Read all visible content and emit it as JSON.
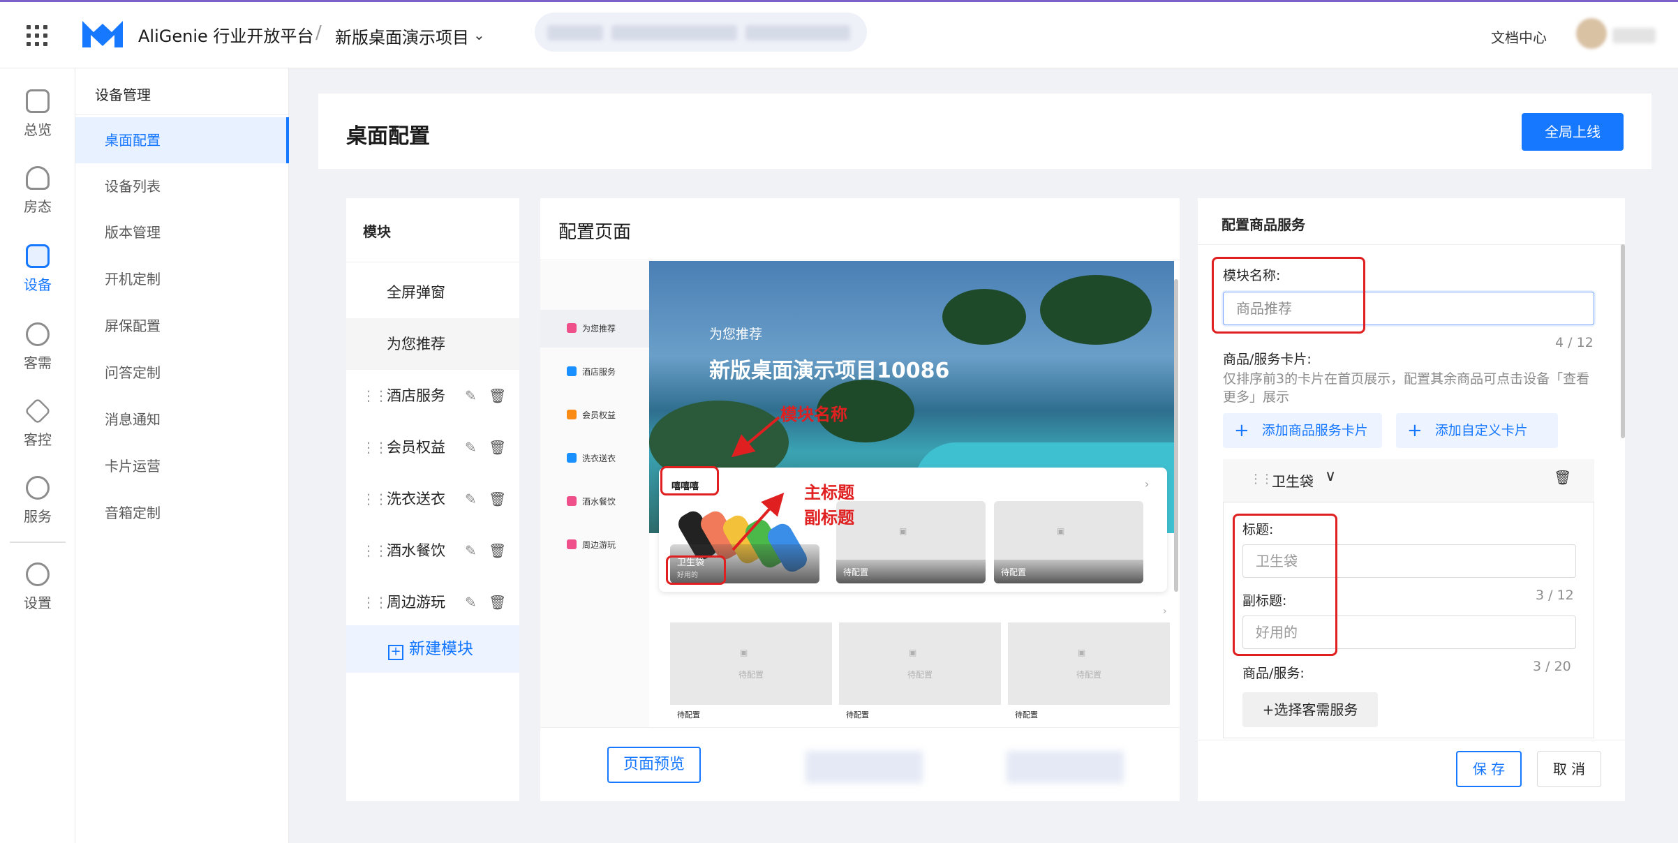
{
  "topbar": {
    "brand": "AliGenie 行业开放平台",
    "separator": "/",
    "project": "新版桌面演示项目",
    "doc_center": "文档中心",
    "icons": [
      "grid-icon",
      "logo-icon",
      "chevron-down-icon"
    ]
  },
  "leftnav": [
    {
      "label": "总览",
      "icon": "overview-icon"
    },
    {
      "label": "房态",
      "icon": "room-status-icon"
    },
    {
      "label": "设备",
      "icon": "device-icon",
      "active": true
    },
    {
      "label": "客需",
      "icon": "guest-needs-icon"
    },
    {
      "label": "客控",
      "icon": "guest-control-icon"
    },
    {
      "label": "服务",
      "icon": "service-icon"
    },
    {
      "label": "设置",
      "icon": "settings-icon"
    }
  ],
  "sub_sidebar": {
    "title": "设备管理",
    "items": [
      "桌面配置",
      "设备列表",
      "版本管理",
      "开机定制",
      "屏保配置",
      "问答定制",
      "消息通知",
      "卡片运营",
      "音箱定制"
    ]
  },
  "header": {
    "title": "桌面配置",
    "publish_label": "全局上线"
  },
  "modules": {
    "head": "模块",
    "items": [
      {
        "label": "全屏弹窗",
        "editable": false
      },
      {
        "label": "为您推荐",
        "editable": false
      },
      {
        "label": "酒店服务",
        "editable": true
      },
      {
        "label": "会员权益",
        "editable": true
      },
      {
        "label": "洗衣送衣",
        "editable": true
      },
      {
        "label": "酒水餐饮",
        "editable": true
      },
      {
        "label": "周边游玩",
        "editable": true
      }
    ],
    "new_label": "新建模块"
  },
  "config": {
    "title": "配置页面",
    "phone_nav": [
      "为您推荐",
      "酒店服务",
      "会员权益",
      "洗衣送衣",
      "酒水餐饮",
      "周边游玩"
    ],
    "hero_sub": "为您推荐",
    "hero_title": "新版桌面演示项目10086",
    "card_title": "嘻嘻嘻",
    "product_title": "卫生袋",
    "product_sub": "好用的",
    "pending": "待配置",
    "annotations": {
      "module_name": "模块名称",
      "main_title": "主标题",
      "subtitle": "副标题"
    },
    "preview_label": "页面预览"
  },
  "service": {
    "title": "配置商品服务",
    "module_name_label": "模块名称:",
    "module_name_value": "商品推荐",
    "module_name_count": "4 / 12",
    "cards_label": "商品/服务卡片:",
    "cards_help": "仅排序前3的卡片在首页展示，配置其余商品可点击设备「查看更多」展示",
    "add_product_card": "添加商品服务卡片",
    "add_custom_card": "添加自定义卡片",
    "item_name": "卫生袋",
    "title_label": "标题:",
    "title_placeholder": "卫生袋",
    "subtitle_label": "副标题:",
    "subtitle_count": "3 / 12",
    "subtitle_placeholder": "好用的",
    "goods_label": "商品/服务:",
    "goods_count": "3 / 20",
    "choose_service": "+选择客需服务",
    "save": "保 存",
    "cancel": "取 消"
  },
  "colors": {
    "accent": "#1677ff",
    "annotation": "#e02020",
    "top_border": "#7b61c9"
  }
}
